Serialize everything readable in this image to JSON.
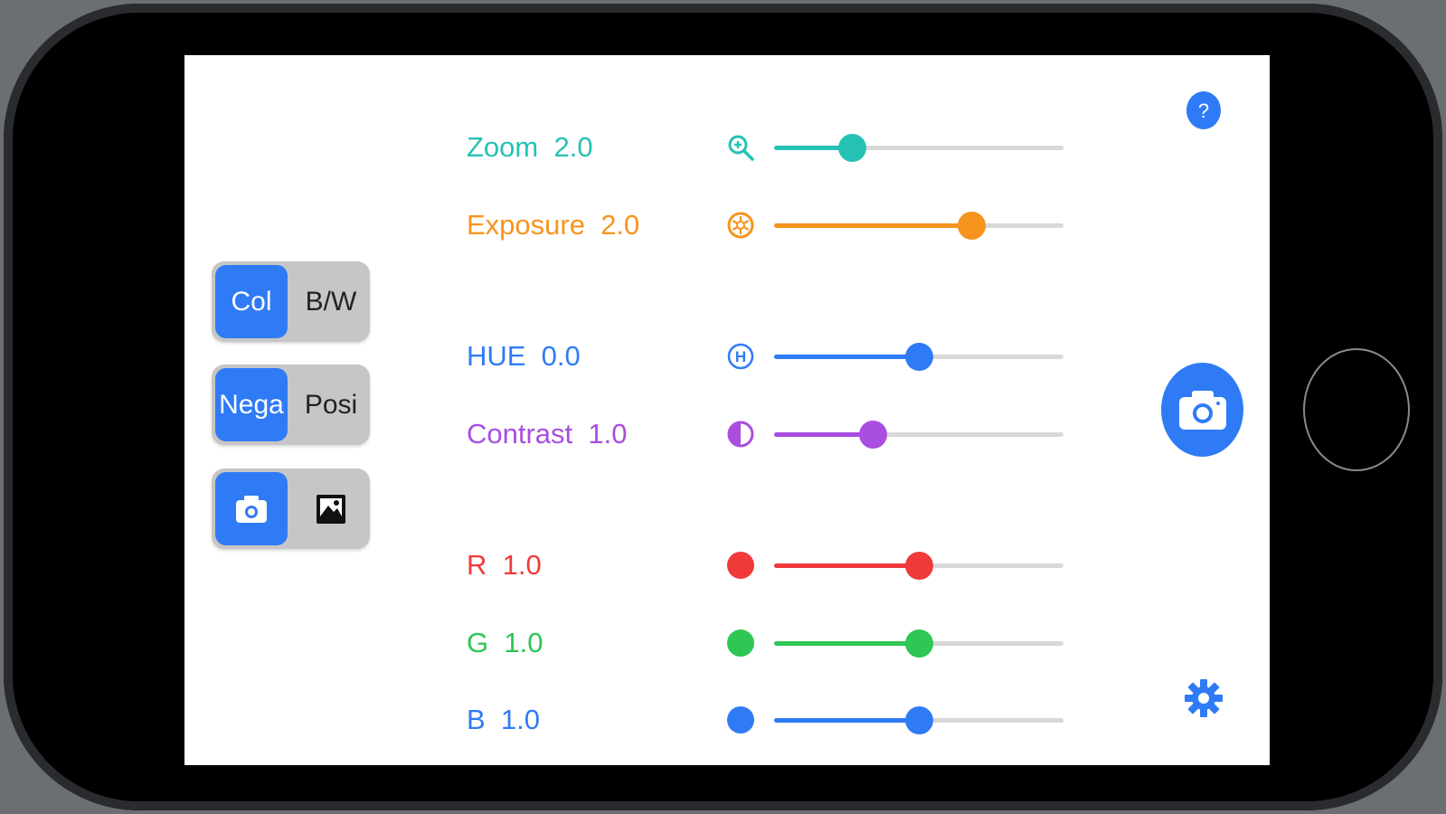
{
  "toggles": {
    "color_mode": {
      "left": "Col",
      "right": "B/W",
      "selected": "left"
    },
    "film_mode": {
      "left": "Nega",
      "right": "Posi",
      "selected": "left"
    },
    "source_mode": {
      "left_icon": "camera-icon",
      "right_icon": "photo-library-icon",
      "selected": "left"
    }
  },
  "sliders": [
    {
      "id": "zoom",
      "label": "Zoom  2.0",
      "icon": "zoom-icon",
      "color": "#25c2b4",
      "level": 0.27
    },
    {
      "id": "exposure",
      "label": "Exposure  2.0",
      "icon": "exposure-icon",
      "color": "#f7941d",
      "level": 0.68
    },
    {
      "id": "hue",
      "label": "HUE  0.0",
      "icon": "hue-icon",
      "color": "#2f7bf6",
      "level": 0.5
    },
    {
      "id": "contrast",
      "label": "Contrast  1.0",
      "icon": "contrast-icon",
      "color": "#a94ee0",
      "level": 0.34
    },
    {
      "id": "red",
      "label": "R  1.0",
      "icon": "red-dot-icon",
      "color": "#f03a3a",
      "level": 0.5
    },
    {
      "id": "green",
      "label": "G  1.0",
      "icon": "green-dot-icon",
      "color": "#2ec655",
      "level": 0.5
    },
    {
      "id": "blue",
      "label": "B  1.0",
      "icon": "blue-dot-icon",
      "color": "#2f7bf6",
      "level": 0.5
    }
  ],
  "icons": {
    "help": "help-icon",
    "shutter": "camera-shutter-icon",
    "settings": "gear-icon"
  },
  "accent": "#2f7bf6"
}
